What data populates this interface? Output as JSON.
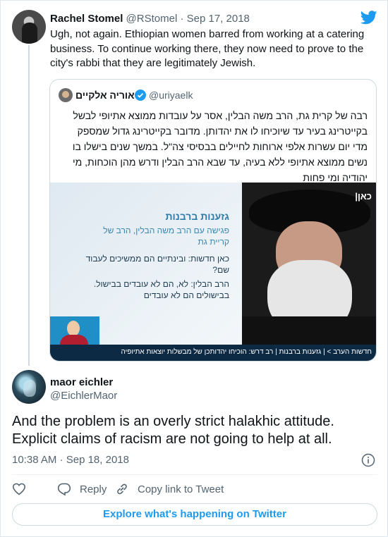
{
  "parent_tweet": {
    "author_name": "Rachel Stomel",
    "author_handle": "@RStomel",
    "separator": "·",
    "date": "Sep 17, 2018",
    "text": "Ugh, not again. Ethiopian women barred from working at a catering business. To continue working there, they now need to prove to the city's rabbi that they are legitimately Jewish.",
    "quoted_tweet": {
      "author_name": "אוריה אלקיים",
      "author_handle": "@uriyaelk",
      "text": "רבה של קרית גת, הרב משה הבלין, אסר על עובדות ממוצא אתיופי לבשל בקייטרינג בעיר עד שיוכיחו לו את יהדותן. מדובר בקייטרינג גדול שמספק מדי יום עשרות אלפי ארוחות לחיילים בבסיסי צה\"ל. במשך שנים בישלו בו נשים ממוצא אתיופי ללא בעיה, עד שבא הרב הבלין ודרש מהן הוכחות, מי יהודיה ומי פחות",
      "media": {
        "title": "גזענות ברבנות",
        "subtitle": "פגישה עם הרב משה הבלין, הרב של קריית גת",
        "question": "כאן חדשות: ובינתיים הם ממשיכים לעבוד שם?",
        "answer": "הרב הבלין: לא, הם לא עובדים בבישול. בבישולים הם לא עובדים",
        "logo": "כאן|",
        "ticker": "חדשות הערב > | גזענות ברבנות | רב דרש: הוכיחו יהדותכן של מבשלות יוצאות אתיופיה"
      }
    }
  },
  "main_tweet": {
    "author_name": "maor eichler",
    "author_handle": "@EichlerMaor",
    "text": "And the problem is an overly strict halakhic attitude. Explicit claims of racism are not going to help at all.",
    "time": "10:38 AM",
    "separator": "·",
    "date": "Sep 18, 2018"
  },
  "actions": {
    "reply_label": "Reply",
    "copy_link_label": "Copy link to Tweet"
  },
  "explore_label": "Explore what's happening on Twitter",
  "colors": {
    "accent": "#1d9bf0",
    "secondary_text": "#536471",
    "border": "#cfd9de"
  },
  "icons": [
    "twitter-bird-icon",
    "verified-badge-icon",
    "info-icon",
    "heart-icon",
    "reply-icon",
    "link-icon"
  ]
}
